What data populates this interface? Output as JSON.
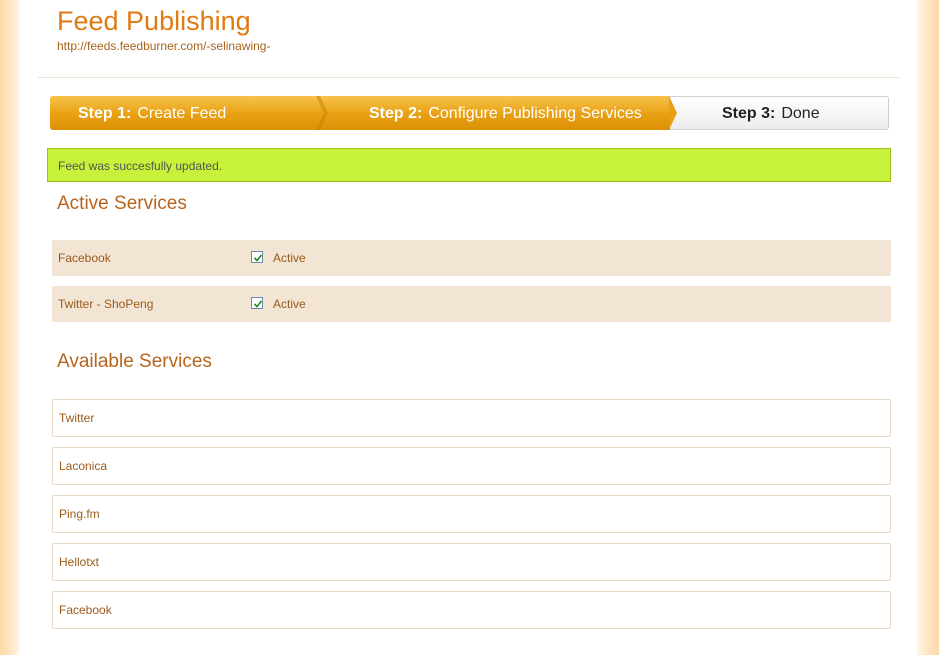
{
  "header": {
    "title": "Feed Publishing",
    "url": "http://feeds.feedburner.com/-selinawing-"
  },
  "steps": [
    {
      "num": "Step 1:",
      "label": "Create Feed"
    },
    {
      "num": "Step 2:",
      "label": "Configure Publishing Services"
    },
    {
      "num": "Step 3:",
      "label": "Done"
    }
  ],
  "flash": {
    "message": "Feed was succesfully updated."
  },
  "active_services": {
    "heading": "Active Services",
    "items": [
      {
        "name": "Facebook",
        "status": "Active"
      },
      {
        "name": "Twitter - ShoPeng",
        "status": "Active"
      }
    ]
  },
  "available_services": {
    "heading": "Available Services",
    "items": [
      "Twitter",
      "Laconica",
      "Ping.fm",
      "Hellotxt",
      "Facebook"
    ]
  },
  "colors": {
    "accent": "#e07a12",
    "step_active": "#e8a012",
    "flash_bg": "#c8f13a",
    "row_bg": "#f3e5d4"
  }
}
